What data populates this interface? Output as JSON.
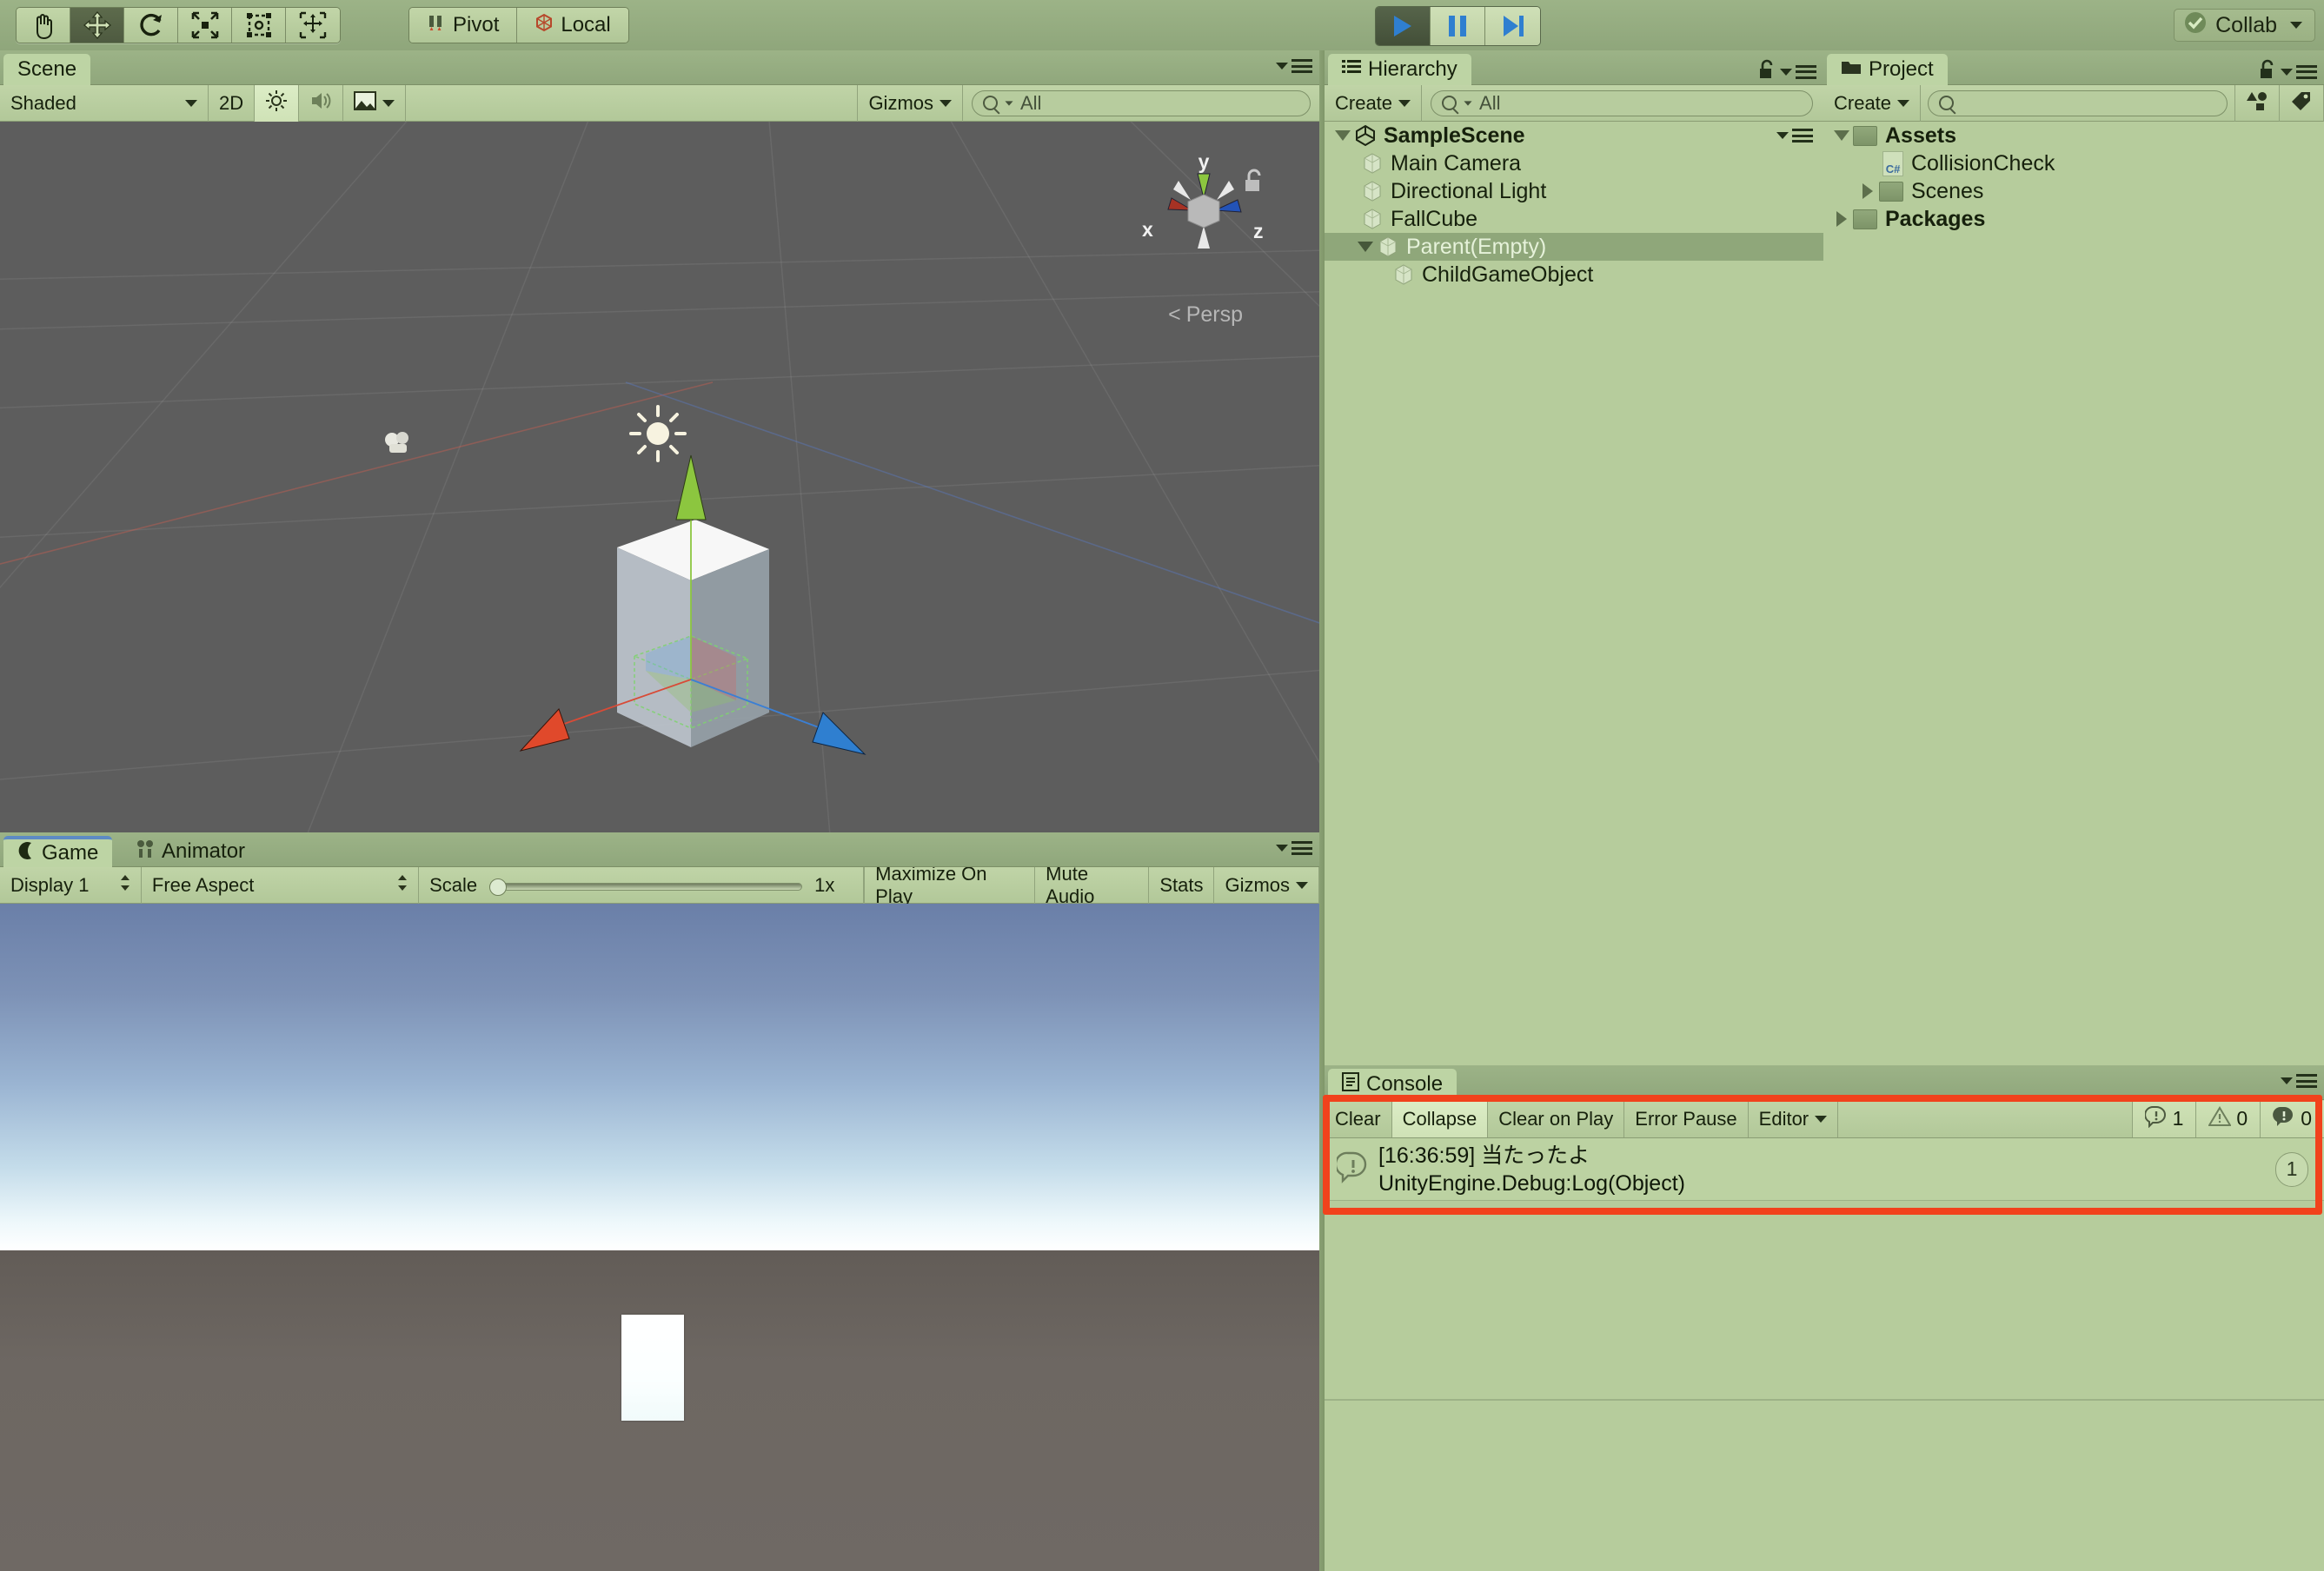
{
  "app": {
    "title": "Unity Editor"
  },
  "toolbar": {
    "tools": [
      {
        "name": "hand-tool",
        "label": "Hand Tool",
        "active": false
      },
      {
        "name": "move-tool",
        "label": "Move Tool",
        "active": true
      },
      {
        "name": "rotate-tool",
        "label": "Rotate Tool",
        "active": false
      },
      {
        "name": "scale-tool",
        "label": "Scale Tool",
        "active": false
      },
      {
        "name": "rect-tool",
        "label": "Rect Tool",
        "active": false
      },
      {
        "name": "transform-tool",
        "label": "Transform Tool",
        "active": false
      }
    ],
    "pivot_label": "Pivot",
    "local_label": "Local",
    "play_label": "Play",
    "pause_label": "Pause",
    "step_label": "Step",
    "play_active": true,
    "collab_label": "Collab"
  },
  "scene_panel": {
    "tab_label": "Scene",
    "draw_mode": "Shaded",
    "toggle_2d": "2D",
    "lighting_icon": "lighting-icon",
    "audio_icon": "audio-icon",
    "fx_icon": "effects-icon",
    "gizmos_label": "Gizmos",
    "search_value": "All",
    "gizmo_axes": {
      "x": "x",
      "y": "y",
      "z": "z"
    },
    "projection_label": "Persp"
  },
  "game_panel": {
    "tabs": [
      {
        "label": "Game",
        "active": true,
        "icon": "game-icon"
      },
      {
        "label": "Animator",
        "active": false,
        "icon": "animator-icon"
      }
    ],
    "display": "Display 1",
    "aspect": "Free Aspect",
    "scale_label": "Scale",
    "scale_value": "1x",
    "maximize_label": "Maximize On Play",
    "mute_label": "Mute Audio",
    "stats_label": "Stats",
    "gizmos_label": "Gizmos"
  },
  "hierarchy": {
    "tab_label": "Hierarchy",
    "create_label": "Create",
    "search_value": "All",
    "items": [
      {
        "label": "SampleScene",
        "depth": 0,
        "fold": "down",
        "icon": "unity-scene-icon",
        "selected": false,
        "bold": true
      },
      {
        "label": "Main Camera",
        "depth": 1,
        "fold": "none",
        "icon": "gameobject-icon",
        "selected": false,
        "bold": false
      },
      {
        "label": "Directional Light",
        "depth": 1,
        "fold": "none",
        "icon": "gameobject-icon",
        "selected": false,
        "bold": false
      },
      {
        "label": "FallCube",
        "depth": 1,
        "fold": "none",
        "icon": "gameobject-icon",
        "selected": false,
        "bold": false
      },
      {
        "label": "Parent(Empty)",
        "depth": 1,
        "fold": "down",
        "icon": "gameobject-icon",
        "selected": true,
        "bold": false
      },
      {
        "label": "ChildGameObject",
        "depth": 2,
        "fold": "none",
        "icon": "gameobject-icon",
        "selected": false,
        "bold": false
      }
    ]
  },
  "project": {
    "tab_label": "Project",
    "create_label": "Create",
    "search_value": "",
    "items": [
      {
        "label": "Assets",
        "depth": 0,
        "fold": "down",
        "icon": "folder-icon",
        "bold": true
      },
      {
        "label": "CollisionCheck",
        "depth": 1,
        "fold": "none",
        "icon": "csharp-script-icon",
        "bold": false
      },
      {
        "label": "Scenes",
        "depth": 1,
        "fold": "right",
        "icon": "folder-icon",
        "bold": false
      },
      {
        "label": "Packages",
        "depth": 0,
        "fold": "right",
        "icon": "folder-icon",
        "bold": true
      }
    ]
  },
  "console": {
    "tab_label": "Console",
    "buttons": [
      {
        "label": "Clear",
        "name": "clear-button",
        "lit": false
      },
      {
        "label": "Collapse",
        "name": "collapse-button",
        "lit": true
      },
      {
        "label": "Clear on Play",
        "name": "clear-on-play-button",
        "lit": false
      },
      {
        "label": "Error Pause",
        "name": "error-pause-button",
        "lit": false
      },
      {
        "label": "Editor",
        "name": "editor-dropdown",
        "lit": false
      }
    ],
    "counts": {
      "info": "1",
      "warning": "0",
      "error": "0"
    },
    "entries": [
      {
        "line1": "[16:36:59] 当たったよ",
        "line2": "UnityEngine.Debug:Log(Object)",
        "badge": "1",
        "type": "info"
      }
    ],
    "highlight_color": "#f1421c"
  },
  "colors": {
    "chrome": "#93ab7e",
    "panel_bg": "#b6cc9c",
    "subbar": "#bed3a5",
    "selection": "#8fa77a",
    "scene_bg": "#5d5d5d",
    "highlight_red": "#f1421c",
    "axis_x": "#d84b37",
    "axis_y": "#8cc63f",
    "axis_z": "#3b7fd4",
    "sky_top": "#6a7fa8",
    "ground": "#6d6762"
  }
}
